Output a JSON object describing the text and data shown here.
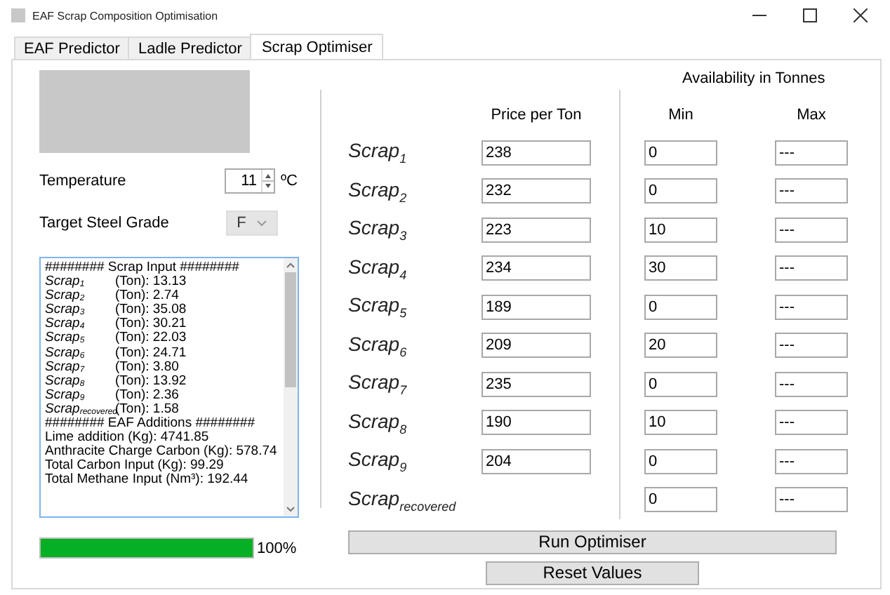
{
  "window": {
    "title": "EAF Scrap Composition Optimisation"
  },
  "tabs": [
    {
      "label": "EAF Predictor",
      "selected": false
    },
    {
      "label": "Ladle Predictor",
      "selected": false
    },
    {
      "label": "Scrap Optimiser",
      "selected": true
    }
  ],
  "temperature": {
    "label": "Temperature",
    "value": "11",
    "unit": "ºC"
  },
  "grade": {
    "label": "Target Steel Grade",
    "value": "F",
    "disabled": true
  },
  "log": [
    {
      "kind": "plain",
      "text": "######## Scrap Input ########"
    },
    {
      "kind": "scrap",
      "label": "Scrap$_{1}$",
      "value": "(Ton): 13.13"
    },
    {
      "kind": "scrap",
      "label": "Scrap$_{2}$",
      "value": "(Ton): 2.74"
    },
    {
      "kind": "scrap",
      "label": "Scrap$_{3}$",
      "value": "(Ton): 35.08"
    },
    {
      "kind": "scrap",
      "label": "Scrap$_{4}$",
      "value": "(Ton): 30.21"
    },
    {
      "kind": "scrap",
      "label": "Scrap$_{5}$",
      "value": "(Ton): 22.03"
    },
    {
      "kind": "scrap",
      "label": "Scrap$_{6}$",
      "value": "(Ton): 24.71"
    },
    {
      "kind": "scrap",
      "label": "Scrap$_{7}$",
      "value": "(Ton): 3.80"
    },
    {
      "kind": "scrap",
      "label": "Scrap$_{8}$",
      "value": "(Ton): 13.92"
    },
    {
      "kind": "scrap",
      "label": "Scrap$_{9}$",
      "value": "(Ton): 2.36"
    },
    {
      "kind": "scrap",
      "label": "Scrap$_{recovered}$",
      "value": "(Ton): 1.58"
    },
    {
      "kind": "plain",
      "text": "######## EAF Additions ########"
    },
    {
      "kind": "plain",
      "text": "Lime addition (Kg): 4741.85"
    },
    {
      "kind": "plain",
      "text": "Anthracite Charge Carbon (Kg): 578.74"
    },
    {
      "kind": "plain",
      "text": "Total Carbon Input (Kg): 99.29"
    },
    {
      "kind": "plain",
      "text": "Total Methane Input (Nm³): 192.44"
    }
  ],
  "progress": {
    "level": 1,
    "reading": "100%"
  },
  "availability_title": "Availability in Tonnes",
  "columns": {
    "price": "Price per Ton",
    "min": "Min",
    "max": "Max"
  },
  "scraps": [
    {
      "label": "Scrap$_{1}$",
      "price": "238",
      "min": "0",
      "max": "---"
    },
    {
      "label": "Scrap$_{2}$",
      "price": "232",
      "min": "0",
      "max": "---"
    },
    {
      "label": "Scrap$_{3}$",
      "price": "223",
      "min": "10",
      "max": "---"
    },
    {
      "label": "Scrap$_{4}$",
      "price": "234",
      "min": "30",
      "max": "---"
    },
    {
      "label": "Scrap$_{5}$",
      "price": "189",
      "min": "0",
      "max": "---"
    },
    {
      "label": "Scrap$_{6}$",
      "price": "209",
      "min": "20",
      "max": "---"
    },
    {
      "label": "Scrap$_{7}$",
      "price": "235",
      "min": "0",
      "max": "---"
    },
    {
      "label": "Scrap$_{8}$",
      "price": "190",
      "min": "10",
      "max": "---"
    },
    {
      "label": "Scrap$_{9}$",
      "price": "204",
      "min": "0",
      "max": "---"
    },
    {
      "label": "Scrap$_{recovered}$",
      "min": "0",
      "max": "---"
    }
  ],
  "buttons": {
    "run": "Run Optimiser",
    "reset": "Reset Values"
  }
}
